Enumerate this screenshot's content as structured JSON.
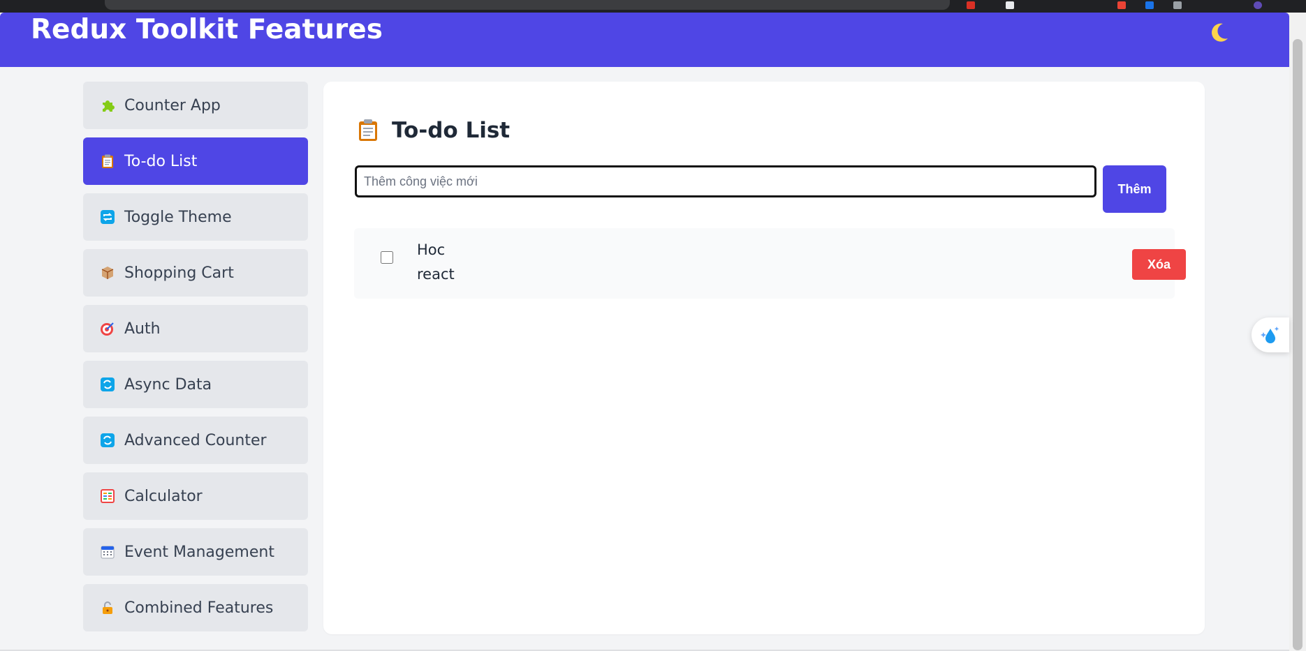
{
  "header": {
    "title": "Redux Toolkit Features",
    "theme_toggle_icon": "moon-icon",
    "brand_color": "#4f46e5"
  },
  "sidebar": {
    "active_index": 1,
    "items": [
      {
        "label": "Counter App",
        "icon": "puzzle-piece-icon"
      },
      {
        "label": "To-do List",
        "icon": "clipboard-icon"
      },
      {
        "label": "Toggle Theme",
        "icon": "repeat-arrows-icon"
      },
      {
        "label": "Shopping Cart",
        "icon": "package-box-icon"
      },
      {
        "label": "Auth",
        "icon": "target-icon"
      },
      {
        "label": "Async Data",
        "icon": "refresh-icon"
      },
      {
        "label": "Advanced Counter",
        "icon": "refresh-icon"
      },
      {
        "label": "Calculator",
        "icon": "abacus-icon"
      },
      {
        "label": "Event Management",
        "icon": "calendar-icon"
      },
      {
        "label": "Combined Features",
        "icon": "padlock-icon"
      }
    ]
  },
  "main": {
    "title": "To-do List",
    "title_icon": "clipboard-icon",
    "input": {
      "placeholder": "Thêm công việc mới",
      "value": ""
    },
    "add_button_label": "Thêm",
    "todos": [
      {
        "text": "Hoc react",
        "completed": false,
        "delete_label": "Xóa"
      }
    ]
  },
  "floating_widget": {
    "icon": "sparkle-droplet-icon"
  },
  "colors": {
    "accent": "#4f46e5",
    "danger": "#ef4444",
    "sidebar_item_bg": "#e5e7eb",
    "page_bg": "#f3f4f6"
  }
}
